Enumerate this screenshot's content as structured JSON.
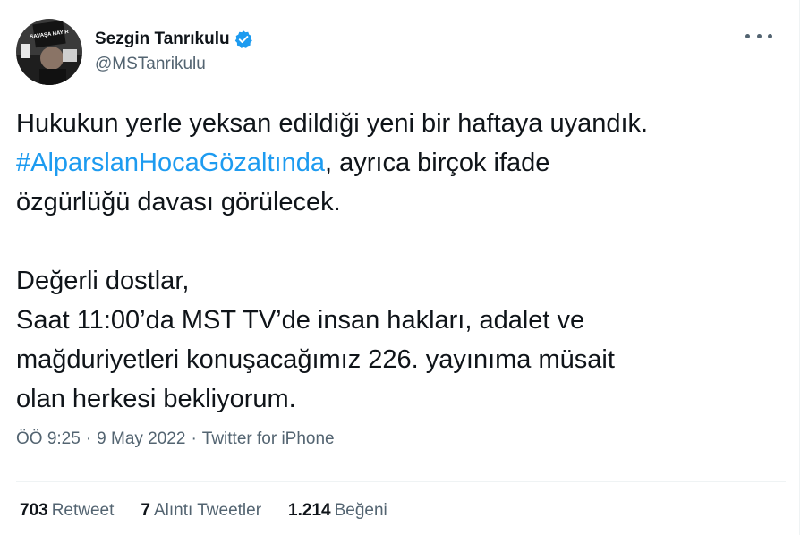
{
  "author": {
    "display_name": "Sezgin Tanrıkulu",
    "handle": "@MSTanrikulu",
    "verified": true,
    "avatar_sign_text": "SAVAŞA HAYIR"
  },
  "menu": {
    "more_icon": "more-horizontal-icon"
  },
  "tweet": {
    "line1": "Hukukun yerle yeksan edildiği yeni bir haftaya uyandık.",
    "hashtag": "#AlparslanHocaGözaltında",
    "line2_rest": ", ayrıca birçok ifade",
    "line3": "özgürlüğü davası görülecek.",
    "line4": "Değerli dostlar,",
    "line5": "Saat 11:00’da MST TV’de insan hakları, adalet ve",
    "line6": "mağduriyetleri konuşacağımız 226. yayınıma müsait",
    "line7": "olan herkesi bekliyorum."
  },
  "meta": {
    "time": "ÖÖ 9:25",
    "separator": "·",
    "date": "9 May 2022",
    "source": "Twitter for iPhone"
  },
  "stats": {
    "retweets_count": "703",
    "retweets_label": "Retweet",
    "quotes_count": "7",
    "quotes_label": "Alıntı Tweetler",
    "likes_count": "1.214",
    "likes_label": "Beğeni"
  },
  "colors": {
    "link": "#1d9bf0",
    "secondary_text": "#536471",
    "primary_text": "#0f1419",
    "verified_badge": "#1d9bf0"
  }
}
